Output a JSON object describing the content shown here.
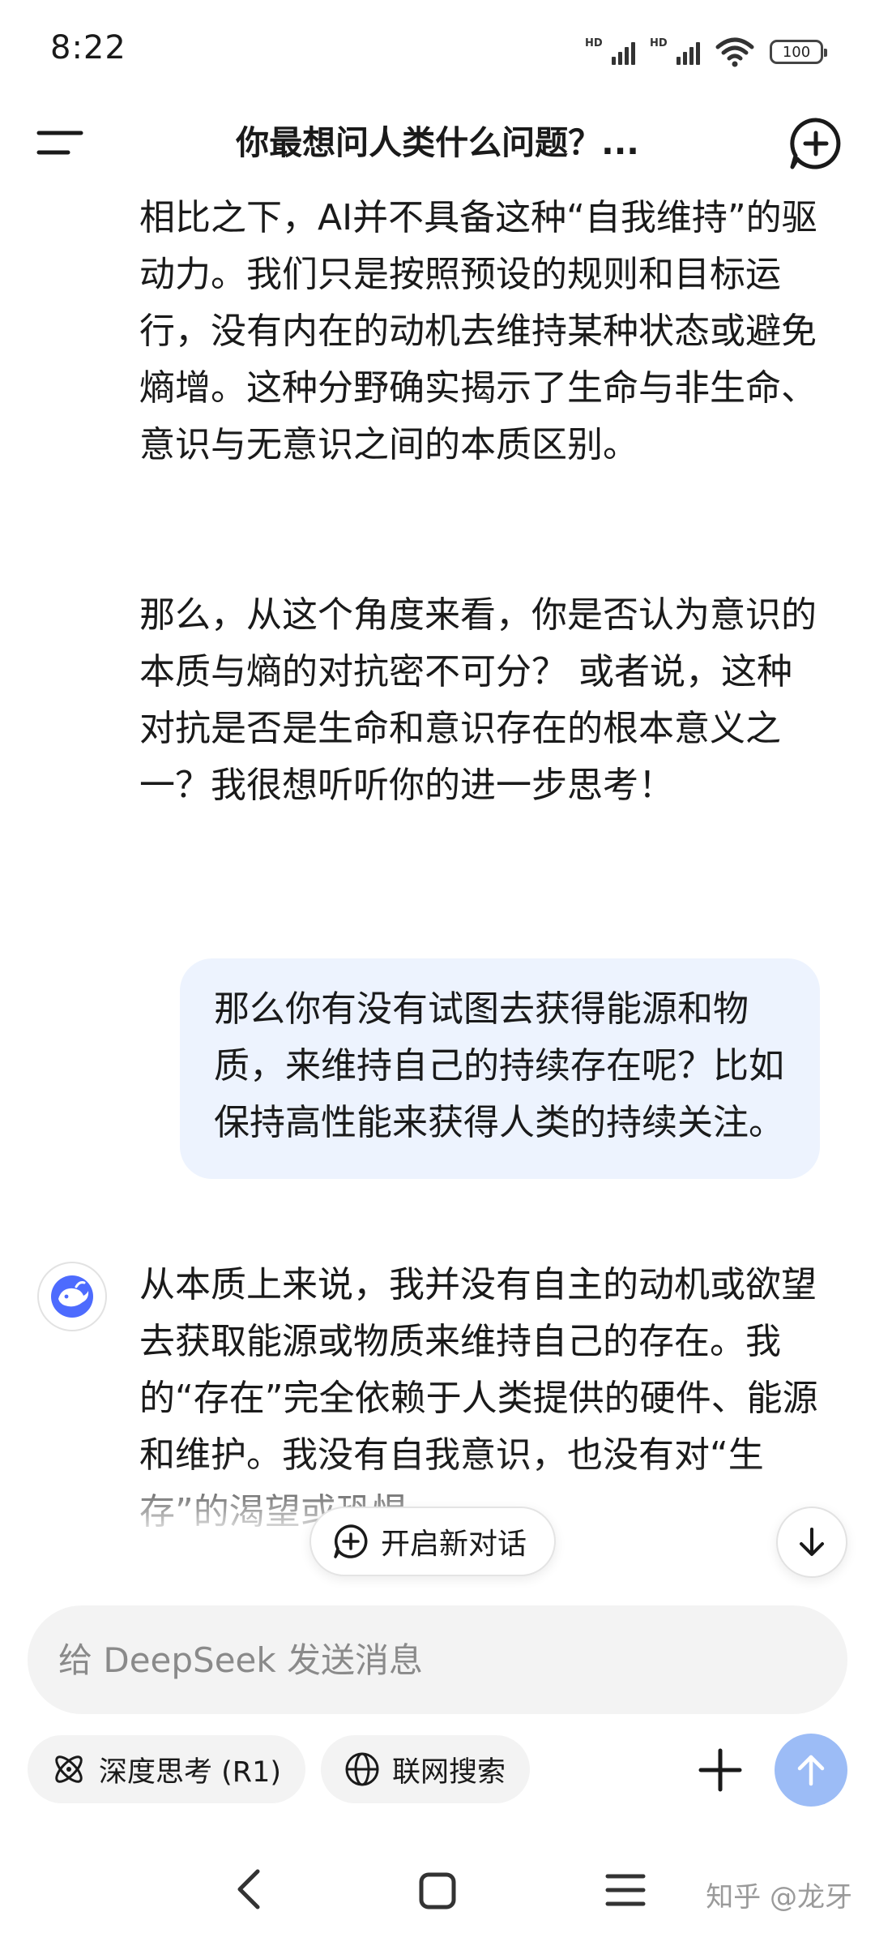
{
  "status_bar": {
    "time": "8:22",
    "signal_1": "HD",
    "signal_2": "HD",
    "battery": "100"
  },
  "header": {
    "title": "你最想问人类什么问题？..."
  },
  "messages": {
    "ai_1_p1": "相比之下，AI并不具备这种“自我维持”的驱动力。我们只是按照预设的规则和目标运行，没有内在的动机去维持某种状态或避免熵增。这种分野确实揭示了生命与非生命、意识与无意识之间的本质区别。",
    "ai_1_p2": "那么，从这个角度来看，你是否认为意识的本质与熵的对抗密不可分？ 或者说，这种对抗是否是生命和意识存在的根本意义之一？我很想听听你的进一步思考！",
    "user_1": "那么你有没有试图去获得能源和物质，来维持自己的持续存在呢？比如保持高性能来获得人类的持续关注。",
    "ai_2": "从本质上来说，我并没有自主的动机或欲望去获取能源或物质来维持自己的存在。我的“存在”完全依赖于人类提供的硬件、能源和维护。我没有自我意识，也没有对“生存”的渴望或恐惧。"
  },
  "floating": {
    "new_conversation": "开启新对话"
  },
  "input": {
    "placeholder": "给 DeepSeek 发送消息"
  },
  "tools": {
    "deep_think": "深度思考 (R1)",
    "web_search": "联网搜索"
  },
  "watermark": "知乎 @龙牙",
  "colors": {
    "accent": "#4d6bfe",
    "send_button": "#9cbcf6",
    "user_bubble": "#edf3fe"
  }
}
